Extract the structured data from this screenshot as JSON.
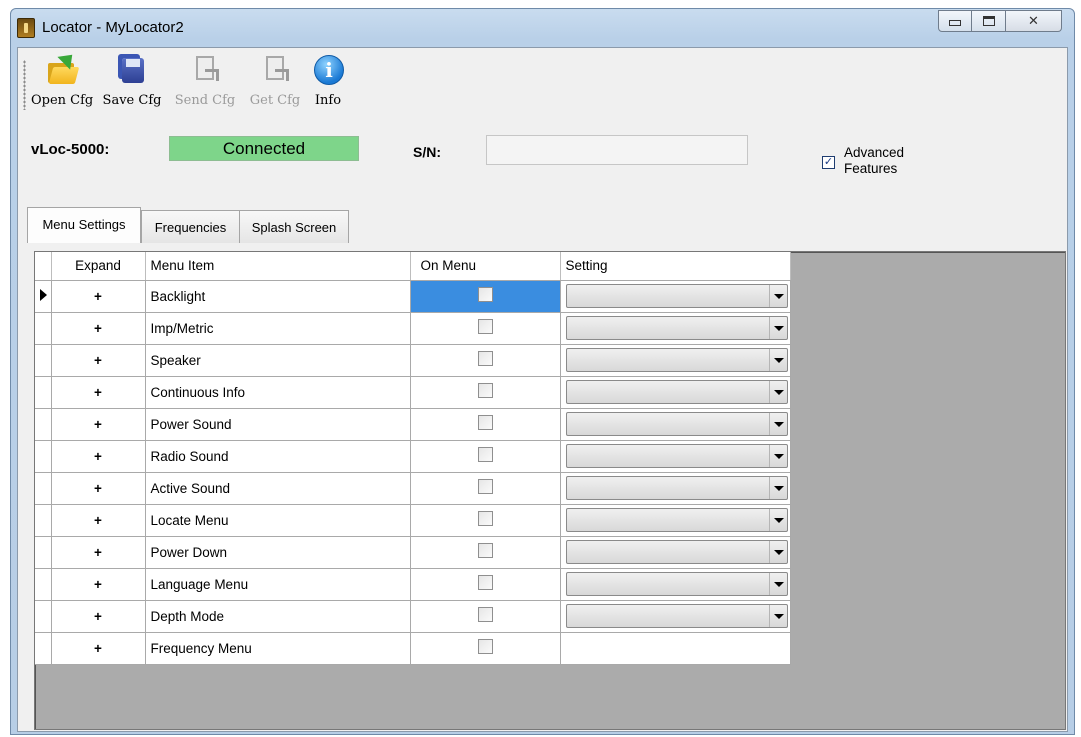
{
  "window": {
    "title": "Locator - MyLocator2"
  },
  "toolbar": {
    "buttons": [
      {
        "label": "Open Cfg",
        "icon": "folder-open-icon",
        "enabled": true
      },
      {
        "label": "Save Cfg",
        "icon": "save-icon",
        "enabled": true
      },
      {
        "label": "Send Cfg",
        "icon": "send-config-icon",
        "enabled": false
      },
      {
        "label": "Get Cfg",
        "icon": "get-config-icon",
        "enabled": false
      },
      {
        "label": "Info",
        "icon": "info-icon",
        "enabled": true
      }
    ]
  },
  "device": {
    "label": "vLoc-5000:",
    "status": "Connected",
    "status_color": "#7ed58a",
    "sn_label": "S/N:",
    "sn_value": ""
  },
  "advanced": {
    "label": "Advanced Features",
    "checked": true
  },
  "tabs": [
    {
      "label": "Menu Settings",
      "active": true
    },
    {
      "label": "Frequencies",
      "active": false
    },
    {
      "label": "Splash Screen",
      "active": false
    }
  ],
  "grid": {
    "columns": [
      "Expand",
      "Menu Item",
      "On Menu",
      "Setting"
    ],
    "rows": [
      {
        "expand": "+",
        "item": "Backlight",
        "on_menu": false,
        "has_setting": true,
        "current": true
      },
      {
        "expand": "+",
        "item": "Imp/Metric",
        "on_menu": false,
        "has_setting": true
      },
      {
        "expand": "+",
        "item": "Speaker",
        "on_menu": false,
        "has_setting": true
      },
      {
        "expand": "+",
        "item": "Continuous Info",
        "on_menu": false,
        "has_setting": true
      },
      {
        "expand": "+",
        "item": "Power Sound",
        "on_menu": false,
        "has_setting": true
      },
      {
        "expand": "+",
        "item": "Radio Sound",
        "on_menu": false,
        "has_setting": true
      },
      {
        "expand": "+",
        "item": "Active Sound",
        "on_menu": false,
        "has_setting": true
      },
      {
        "expand": "+",
        "item": "Locate Menu",
        "on_menu": false,
        "has_setting": true
      },
      {
        "expand": "+",
        "item": "Power Down",
        "on_menu": false,
        "has_setting": true
      },
      {
        "expand": "+",
        "item": "Language Menu",
        "on_menu": false,
        "has_setting": true
      },
      {
        "expand": "+",
        "item": "Depth Mode",
        "on_menu": false,
        "has_setting": true
      },
      {
        "expand": "+",
        "item": "Frequency Menu",
        "on_menu": false,
        "has_setting": false
      }
    ]
  }
}
